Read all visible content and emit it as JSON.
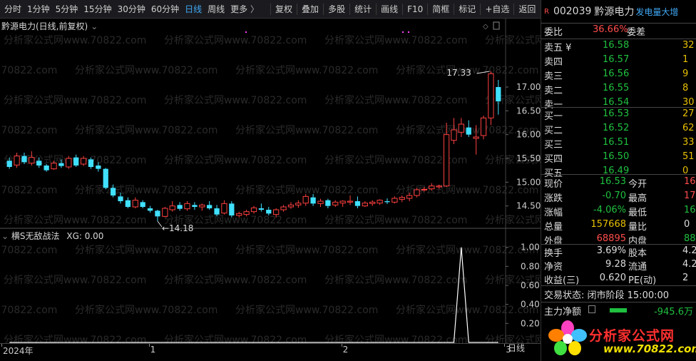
{
  "toolbar": {
    "items": [
      "分时",
      "1分钟",
      "5分钟",
      "15分钟",
      "30分钟",
      "60分钟",
      "日线",
      "周线",
      "更多"
    ],
    "active_index": 6,
    "more_arrow": "〉",
    "right_items": [
      "复权",
      "叠加",
      "多股",
      "统计",
      "画线",
      "F10",
      "简框",
      "标记",
      "+自选",
      "返回"
    ]
  },
  "main_chart": {
    "title": "黔源电力(日线,前复权)",
    "settings_icon": "chevron-down-icon",
    "high_label": "17.33",
    "low_label": "14.18",
    "y_ticks": [
      "17.00",
      "16.50",
      "16.00",
      "15.50",
      "15.00",
      "14.50"
    ],
    "y_tick_values": [
      17.0,
      16.5,
      16.0,
      15.5,
      15.0,
      14.5
    ],
    "y_range": [
      14.0,
      17.75
    ]
  },
  "chart_data": [
    {
      "type": "candlestick",
      "title": "黔源电力(日线,前复权)",
      "ylim": [
        14.0,
        17.75
      ],
      "colors": {
        "up": "#ff4040",
        "down": "#40e0ff"
      },
      "candles": [
        {
          "o": 15.45,
          "h": 15.52,
          "l": 15.28,
          "c": 15.32
        },
        {
          "o": 15.36,
          "h": 15.62,
          "l": 15.3,
          "c": 15.55
        },
        {
          "o": 15.55,
          "h": 15.62,
          "l": 15.38,
          "c": 15.42
        },
        {
          "o": 15.4,
          "h": 15.65,
          "l": 15.35,
          "c": 15.52
        },
        {
          "o": 15.45,
          "h": 15.52,
          "l": 15.3,
          "c": 15.35
        },
        {
          "o": 15.35,
          "h": 15.38,
          "l": 15.22,
          "c": 15.25
        },
        {
          "o": 15.28,
          "h": 15.45,
          "l": 15.26,
          "c": 15.4
        },
        {
          "o": 15.4,
          "h": 15.48,
          "l": 15.3,
          "c": 15.34
        },
        {
          "o": 15.32,
          "h": 15.55,
          "l": 15.28,
          "c": 15.5
        },
        {
          "o": 15.52,
          "h": 15.58,
          "l": 15.32,
          "c": 15.35
        },
        {
          "o": 15.38,
          "h": 15.55,
          "l": 15.34,
          "c": 15.5
        },
        {
          "o": 15.48,
          "h": 15.52,
          "l": 15.28,
          "c": 15.32
        },
        {
          "o": 15.35,
          "h": 15.42,
          "l": 15.22,
          "c": 15.28
        },
        {
          "o": 15.28,
          "h": 15.3,
          "l": 14.85,
          "c": 14.88
        },
        {
          "o": 14.88,
          "h": 14.95,
          "l": 14.68,
          "c": 14.72
        },
        {
          "o": 14.7,
          "h": 14.78,
          "l": 14.55,
          "c": 14.6
        },
        {
          "o": 14.62,
          "h": 14.68,
          "l": 14.45,
          "c": 14.48
        },
        {
          "o": 14.48,
          "h": 14.68,
          "l": 14.45,
          "c": 14.62
        },
        {
          "o": 14.58,
          "h": 14.62,
          "l": 14.45,
          "c": 14.48
        },
        {
          "o": 14.45,
          "h": 14.5,
          "l": 14.36,
          "c": 14.4
        },
        {
          "o": 14.4,
          "h": 14.42,
          "l": 14.18,
          "c": 14.28
        },
        {
          "o": 14.28,
          "h": 14.48,
          "l": 14.26,
          "c": 14.45
        },
        {
          "o": 14.42,
          "h": 14.6,
          "l": 14.38,
          "c": 14.5
        },
        {
          "o": 14.52,
          "h": 14.58,
          "l": 14.4,
          "c": 14.44
        },
        {
          "o": 14.44,
          "h": 14.6,
          "l": 14.4,
          "c": 14.55
        },
        {
          "o": 14.52,
          "h": 14.58,
          "l": 14.42,
          "c": 14.48
        },
        {
          "o": 14.48,
          "h": 14.55,
          "l": 14.4,
          "c": 14.52
        },
        {
          "o": 14.52,
          "h": 14.6,
          "l": 14.42,
          "c": 14.45
        },
        {
          "o": 14.45,
          "h": 14.52,
          "l": 14.28,
          "c": 14.32
        },
        {
          "o": 14.35,
          "h": 14.62,
          "l": 14.32,
          "c": 14.55
        },
        {
          "o": 14.55,
          "h": 14.6,
          "l": 14.26,
          "c": 14.3
        },
        {
          "o": 14.3,
          "h": 14.38,
          "l": 14.26,
          "c": 14.34
        },
        {
          "o": 14.32,
          "h": 14.42,
          "l": 14.28,
          "c": 14.38
        },
        {
          "o": 14.38,
          "h": 14.5,
          "l": 14.34,
          "c": 14.46
        },
        {
          "o": 14.45,
          "h": 14.55,
          "l": 14.38,
          "c": 14.42
        },
        {
          "o": 14.42,
          "h": 14.48,
          "l": 14.3,
          "c": 14.34
        },
        {
          "o": 14.32,
          "h": 14.45,
          "l": 14.26,
          "c": 14.42
        },
        {
          "o": 14.42,
          "h": 14.52,
          "l": 14.38,
          "c": 14.48
        },
        {
          "o": 14.48,
          "h": 14.58,
          "l": 14.44,
          "c": 14.52
        },
        {
          "o": 14.52,
          "h": 14.62,
          "l": 14.46,
          "c": 14.56
        },
        {
          "o": 14.56,
          "h": 14.75,
          "l": 14.5,
          "c": 14.7
        },
        {
          "o": 14.68,
          "h": 14.75,
          "l": 14.5,
          "c": 14.55
        },
        {
          "o": 14.55,
          "h": 14.65,
          "l": 14.48,
          "c": 14.6
        },
        {
          "o": 14.62,
          "h": 14.65,
          "l": 14.45,
          "c": 14.5
        },
        {
          "o": 14.52,
          "h": 14.62,
          "l": 14.48,
          "c": 14.58
        },
        {
          "o": 14.56,
          "h": 14.62,
          "l": 14.48,
          "c": 14.6
        },
        {
          "o": 14.58,
          "h": 14.72,
          "l": 14.52,
          "c": 14.6
        },
        {
          "o": 14.6,
          "h": 14.7,
          "l": 14.45,
          "c": 14.5
        },
        {
          "o": 14.5,
          "h": 14.6,
          "l": 14.48,
          "c": 14.56
        },
        {
          "o": 14.55,
          "h": 14.62,
          "l": 14.5,
          "c": 14.58
        },
        {
          "o": 14.56,
          "h": 14.64,
          "l": 14.52,
          "c": 14.62
        },
        {
          "o": 14.6,
          "h": 14.66,
          "l": 14.54,
          "c": 14.58
        },
        {
          "o": 14.58,
          "h": 14.7,
          "l": 14.55,
          "c": 14.66
        },
        {
          "o": 14.64,
          "h": 14.72,
          "l": 14.58,
          "c": 14.68
        },
        {
          "o": 14.66,
          "h": 14.78,
          "l": 14.6,
          "c": 14.72
        },
        {
          "o": 14.72,
          "h": 14.88,
          "l": 14.68,
          "c": 14.84
        },
        {
          "o": 14.84,
          "h": 14.9,
          "l": 14.8,
          "c": 14.85
        },
        {
          "o": 14.86,
          "h": 14.98,
          "l": 14.82,
          "c": 14.92
        },
        {
          "o": 14.9,
          "h": 14.95,
          "l": 14.86,
          "c": 14.92
        },
        {
          "o": 14.92,
          "h": 16.25,
          "l": 14.9,
          "c": 16.0
        },
        {
          "o": 15.88,
          "h": 16.35,
          "l": 15.8,
          "c": 16.1
        },
        {
          "o": 16.05,
          "h": 16.35,
          "l": 15.95,
          "c": 16.22
        },
        {
          "o": 16.15,
          "h": 16.3,
          "l": 15.95,
          "c": 16.0
        },
        {
          "o": 15.92,
          "h": 16.2,
          "l": 15.58,
          "c": 15.95
        },
        {
          "o": 15.98,
          "h": 16.4,
          "l": 15.9,
          "c": 16.35
        },
        {
          "o": 16.35,
          "h": 17.33,
          "l": 16.2,
          "c": 17.28
        },
        {
          "o": 17.0,
          "h": 17.15,
          "l": 16.42,
          "c": 16.7
        }
      ]
    },
    {
      "type": "line",
      "title": "横S无敌战法",
      "series": [
        {
          "name": "XG",
          "values_note": "spike at index 61"
        }
      ],
      "spike_index": 61,
      "ylim": [
        0,
        1.05
      ],
      "y_ticks": [
        1.0,
        0.8,
        0.6,
        0.4,
        0.2
      ]
    }
  ],
  "indicator": {
    "title": "横S无敌战法",
    "xg_label": "XG: 0.00",
    "y_ticks": [
      "1.00",
      "0.80",
      "0.60",
      "0.40",
      "0.20"
    ]
  },
  "xaxis": {
    "labels": [
      "2024年",
      "1",
      "2",
      "3"
    ],
    "label_candle_index": [
      0,
      19,
      45,
      67
    ],
    "period": "日线"
  },
  "quote": {
    "r_badge": "R",
    "code": "002039",
    "name": "黔源电力",
    "tag": "发电量大增",
    "weibi_label": "委比",
    "weibi": "36.66%",
    "weicha_label": "委差",
    "sells": [
      {
        "label": "卖五 ¥",
        "price": "16.58",
        "vol": "32"
      },
      {
        "label": "卖四",
        "price": "16.57",
        "vol": "1"
      },
      {
        "label": "卖三",
        "price": "16.56",
        "vol": "9"
      },
      {
        "label": "卖二",
        "price": "16.55",
        "vol": "8"
      },
      {
        "label": "卖一",
        "price": "16.54",
        "vol": "30"
      }
    ],
    "buys": [
      {
        "label": "买一",
        "price": "16.53",
        "vol": "27"
      },
      {
        "label": "买二",
        "price": "16.52",
        "vol": "62"
      },
      {
        "label": "买三",
        "price": "16.51",
        "vol": "33"
      },
      {
        "label": "买四",
        "price": "16.50",
        "vol": "51"
      },
      {
        "label": "买五",
        "price": "16.49",
        "vol": "0"
      }
    ],
    "stats": [
      {
        "l1": "现价",
        "v1": "16.53",
        "l2": "今开",
        "v2": "16",
        "c1": "green",
        "c2": "red"
      },
      {
        "l1": "涨跌",
        "v1": "-0.70",
        "l2": "最高",
        "v2": "17",
        "c1": "green",
        "c2": "red"
      },
      {
        "l1": "涨幅",
        "v1": "-4.06%",
        "l2": "最低",
        "v2": "16",
        "c1": "green",
        "c2": "green"
      },
      {
        "l1": "总量",
        "v1": "157668",
        "l2": "量比",
        "v2": "0",
        "c1": "yellow",
        "c2": "white"
      },
      {
        "l1": "外盘",
        "v1": "68895",
        "l2": "内盘",
        "v2": "88",
        "c1": "red",
        "c2": "green"
      }
    ],
    "stats2": [
      {
        "l1": "换手",
        "v1": "3.69%",
        "l2": "股本",
        "v2": "4.2"
      },
      {
        "l1": "净资",
        "v1": "9.28",
        "l2": "流通",
        "v2": "4.2"
      },
      {
        "l1": "收益(三)",
        "v1": "0.620",
        "l2": "PE(动)",
        "v2": "2"
      }
    ],
    "trade_status": "交易状态: 闭市阶段 15:00:00",
    "main_flow_label": "主力净额",
    "main_flow_value": "-945.6万"
  },
  "promo": {
    "text": "分析家公式网",
    "url": "www.70822.com"
  },
  "watermark": "分析家公式网www.70822.com"
}
